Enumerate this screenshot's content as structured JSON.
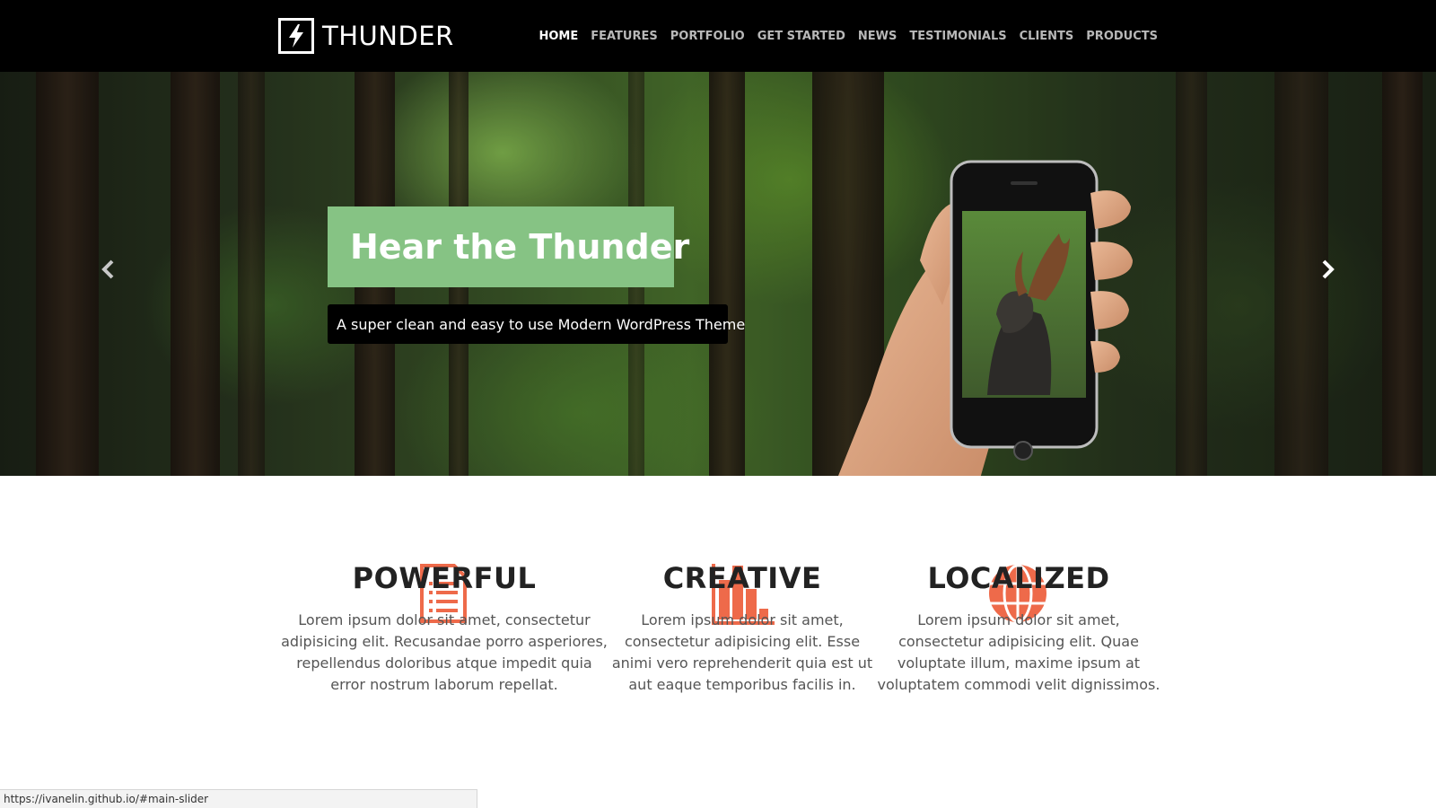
{
  "brand": {
    "name": "THUNDER",
    "icon": "lightning-bolt-icon"
  },
  "nav": {
    "items": [
      {
        "label": "HOME",
        "active": true
      },
      {
        "label": "FEATURES",
        "active": false
      },
      {
        "label": "PORTFOLIO",
        "active": false
      },
      {
        "label": "GET STARTED",
        "active": false
      },
      {
        "label": "NEWS",
        "active": false
      },
      {
        "label": "TESTIMONIALS",
        "active": false
      },
      {
        "label": "CLIENTS",
        "active": false
      },
      {
        "label": "PRODUCTS",
        "active": false
      }
    ]
  },
  "hero": {
    "title": "Hear the Thunder",
    "subtitle": "A super clean and easy to use Modern WordPress Theme",
    "prev_icon": "chevron-left-icon",
    "next_icon": "chevron-right-icon"
  },
  "features": [
    {
      "icon": "document-icon",
      "title": "POWERFUL",
      "lines": [
        "Lorem ipsum dolor sit amet, consectetur",
        "adipisicing elit. Recusandae porro asperiores,",
        "repellendus doloribus atque impedit quia",
        "error nostrum laborum repellat."
      ]
    },
    {
      "icon": "bar-chart-icon",
      "title": "CREATIVE",
      "lines": [
        "Lorem ipsum dolor sit amet,",
        "consectetur adipisicing elit. Esse",
        "animi vero reprehenderit quia est ut",
        "aut eaque temporibus facilis in."
      ]
    },
    {
      "icon": "globe-icon",
      "title": "LOCALIZED",
      "lines": [
        "Lorem ipsum dolor sit amet,",
        "consectetur adipisicing elit. Quae",
        "voluptate illum, maxime ipsum at",
        "voluptatem commodi velit dignissimos."
      ]
    }
  ],
  "colors": {
    "accent": "#ee6a4a",
    "hero_box": "#86c384",
    "nav_bg": "#000000"
  },
  "status_bar": {
    "url": "https://ivanelin.github.io/#main-slider"
  }
}
